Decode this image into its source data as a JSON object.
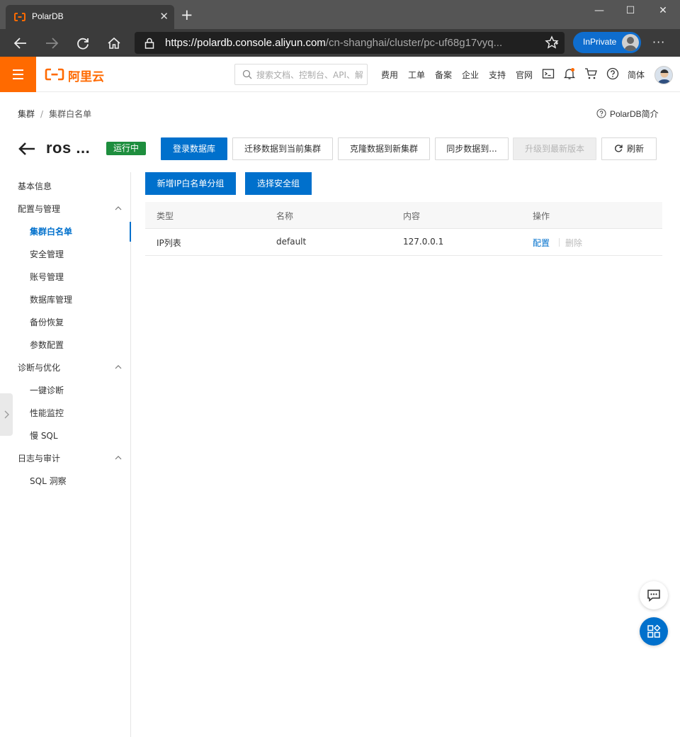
{
  "browser": {
    "tab_title": "PolarDB",
    "url_host": "https://polardb.console.aliyun.com",
    "url_path": "/cn-shanghai/cluster/pc-uf68g17vyq...",
    "inprivate_label": "InPrivate"
  },
  "topbar": {
    "logo_text": "阿里云",
    "search_placeholder": "搜索文档、控制台、API、解",
    "nav": [
      "费用",
      "工单",
      "备案",
      "企业",
      "支持",
      "官网"
    ],
    "language": "简体"
  },
  "breadcrumb": [
    "集群",
    "集群白名单"
  ],
  "intro_link": "PolarDB简介",
  "header": {
    "title": "ros ...",
    "status": "运行中",
    "buttons": {
      "login": "登录数据库",
      "migrate": "迁移数据到当前集群",
      "clone": "克隆数据到新集群",
      "sync": "同步数据到...",
      "upgrade": "升级到最新版本",
      "refresh": "刷新"
    }
  },
  "sidebar": {
    "basic_info": "基本信息",
    "config_group": "配置与管理",
    "whitelist": "集群白名单",
    "security": "安全管理",
    "accounts": "账号管理",
    "databases": "数据库管理",
    "backup": "备份恢复",
    "params": "参数配置",
    "diag_group": "诊断与优化",
    "one_click": "一键诊断",
    "perf": "性能监控",
    "slow_sql": "慢 SQL",
    "log_group": "日志与审计",
    "sql_insight": "SQL 洞察"
  },
  "actions": {
    "add_group": "新增IP白名单分组",
    "select_sg": "选择安全组"
  },
  "table": {
    "headers": [
      "类型",
      "名称",
      "内容",
      "操作"
    ],
    "rows": [
      {
        "type": "IP列表",
        "name": "default",
        "content": "127.0.0.1",
        "op_config": "配置",
        "op_delete": "删除"
      }
    ]
  },
  "colors": {
    "accent": "#0070cc",
    "brand": "#ff6a00",
    "status": "#1e8e3e"
  }
}
